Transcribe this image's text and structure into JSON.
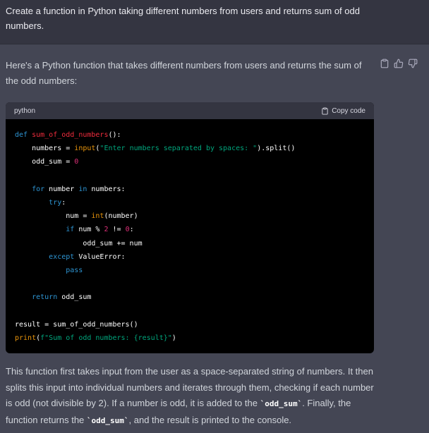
{
  "user": {
    "message": "Create a function in Python taking different numbers from users and returns sum of odd numbers."
  },
  "assistant": {
    "intro": "Here's a Python function that takes different numbers from users and returns the sum of the odd numbers:",
    "code_block": {
      "language": "python",
      "copy_label": "Copy code",
      "lines": [
        [
          {
            "t": "def ",
            "c": "kw"
          },
          {
            "t": "sum_of_odd_numbers",
            "c": "fn"
          },
          {
            "t": "():"
          }
        ],
        [
          {
            "t": "    numbers = "
          },
          {
            "t": "input",
            "c": "bi"
          },
          {
            "t": "("
          },
          {
            "t": "\"Enter numbers separated by spaces: \"",
            "c": "str"
          },
          {
            "t": ").split()"
          }
        ],
        [
          {
            "t": "    odd_sum = "
          },
          {
            "t": "0",
            "c": "num"
          }
        ],
        [],
        [
          {
            "t": "    "
          },
          {
            "t": "for",
            "c": "kw"
          },
          {
            "t": " number "
          },
          {
            "t": "in",
            "c": "kw"
          },
          {
            "t": " numbers:"
          }
        ],
        [
          {
            "t": "        "
          },
          {
            "t": "try",
            "c": "kw"
          },
          {
            "t": ":"
          }
        ],
        [
          {
            "t": "            num = "
          },
          {
            "t": "int",
            "c": "bi"
          },
          {
            "t": "(number)"
          }
        ],
        [
          {
            "t": "            "
          },
          {
            "t": "if",
            "c": "kw"
          },
          {
            "t": " num % "
          },
          {
            "t": "2",
            "c": "num"
          },
          {
            "t": " != "
          },
          {
            "t": "0",
            "c": "num"
          },
          {
            "t": ":"
          }
        ],
        [
          {
            "t": "                odd_sum += num"
          }
        ],
        [
          {
            "t": "        "
          },
          {
            "t": "except",
            "c": "kw"
          },
          {
            "t": " ValueError:"
          }
        ],
        [
          {
            "t": "            "
          },
          {
            "t": "pass",
            "c": "kw"
          }
        ],
        [],
        [
          {
            "t": "    "
          },
          {
            "t": "return",
            "c": "kw"
          },
          {
            "t": " odd_sum"
          }
        ],
        [],
        [
          {
            "t": "result = sum_of_odd_numbers()"
          }
        ],
        [
          {
            "t": "print",
            "c": "bi"
          },
          {
            "t": "("
          },
          {
            "t": "f\"Sum of odd numbers: {result}\"",
            "c": "str"
          },
          {
            "t": ")"
          }
        ]
      ]
    },
    "outro": {
      "part1": "This function first takes input from the user as a space-separated string of numbers. It then splits this input into individual numbers and iterates through them, checking if each number is odd (not divisible by 2). If a number is odd, it is added to the ",
      "code1": "`odd_sum`",
      "part2": ". Finally, the function returns the ",
      "code2": "`odd_sum`",
      "part3": ", and the result is printed to the console."
    }
  },
  "icons": {
    "copy": "clipboard-icon",
    "thumbs_up": "thumbs-up-icon",
    "thumbs_down": "thumbs-down-icon"
  },
  "colors": {
    "user_bg": "#343541",
    "assistant_bg": "#444654",
    "code_bg": "#000000",
    "keyword": "#2e95d3",
    "function": "#f22c3d",
    "string": "#00a67d",
    "number": "#df3079",
    "builtin": "#e9950c"
  }
}
